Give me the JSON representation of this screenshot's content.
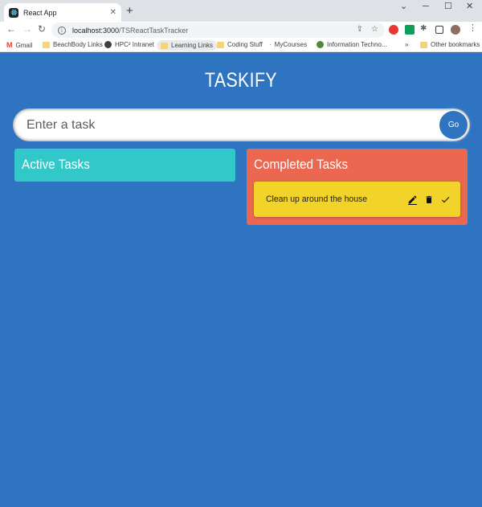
{
  "browser": {
    "tab_title": "React App",
    "tab_close": "✕",
    "new_tab": "+",
    "url_host": "localhost:3000",
    "url_path": "/TSReactTaskTracker",
    "window_controls": {
      "chevron": "⌄",
      "minimize": "─",
      "maximize": "☐",
      "close": "✕"
    },
    "nav": {
      "back": "←",
      "forward": "→",
      "reload": "↻"
    },
    "bookmarks": [
      {
        "label": "Gmail",
        "icon": "gmail-icon"
      },
      {
        "label": "BeachBody Links",
        "icon": "folder-icon"
      },
      {
        "label": "HPC² Intranet",
        "icon": "globe-icon"
      },
      {
        "label": "Learning Links",
        "icon": "folder-icon"
      },
      {
        "label": "Coding Stuff",
        "icon": "folder-icon"
      },
      {
        "label": "MyCourses",
        "icon": "link-icon"
      },
      {
        "label": "Information Techno...",
        "icon": "globe-icon"
      }
    ],
    "bookmarks_overflow": "»",
    "other_bookmarks": "Other bookmarks"
  },
  "app": {
    "heading": "TASKIFY",
    "input_placeholder": "Enter a task",
    "go_label": "Go",
    "active_title": "Active Tasks",
    "completed_title": "Completed Tasks",
    "completed_tasks": [
      {
        "text": "Clean up around the house"
      }
    ]
  },
  "colors": {
    "page_bg": "#2f74c0",
    "active_bg": "#32c7c9",
    "completed_bg": "#eb6750",
    "task_bg": "#f2d329"
  }
}
